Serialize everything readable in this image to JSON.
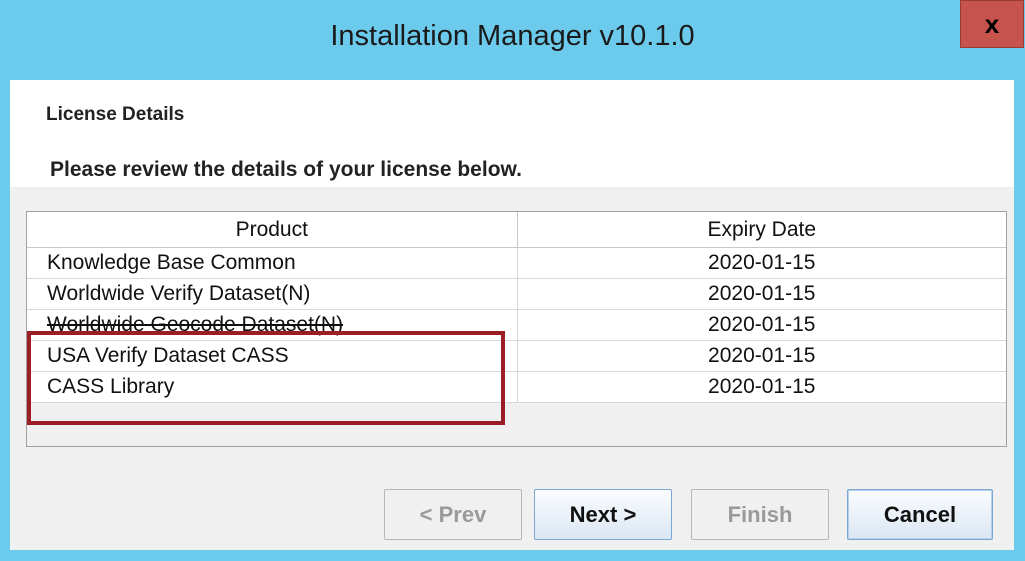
{
  "window": {
    "title": "Installation Manager v10.1.0",
    "close_glyph": "x"
  },
  "header": {
    "section_title": "License Details",
    "subtitle": "Please review the details of your license below."
  },
  "table": {
    "columns": [
      "Product",
      "Expiry Date"
    ],
    "rows": [
      {
        "product": "Knowledge Base Common",
        "expiry": "2020-01-15"
      },
      {
        "product": "Worldwide Verify Dataset(N)",
        "expiry": "2020-01-15"
      },
      {
        "product": "Worldwide Geocode Dataset(N)",
        "expiry": "2020-01-15"
      },
      {
        "product": "USA Verify Dataset CASS",
        "expiry": "2020-01-15"
      },
      {
        "product": "CASS Library",
        "expiry": "2020-01-15"
      }
    ]
  },
  "buttons": {
    "prev": "< Prev",
    "next": "Next >",
    "finish": "Finish",
    "cancel": "Cancel"
  },
  "colors": {
    "titlebar": "#6ccbec",
    "close_button": "#c6544c",
    "highlight_box": "#9b1d25"
  }
}
